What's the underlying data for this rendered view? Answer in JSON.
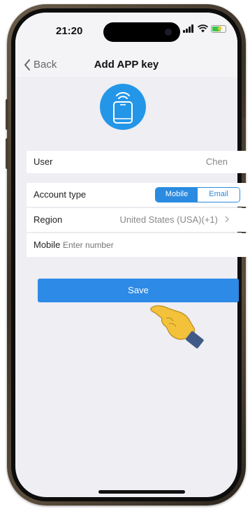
{
  "status_bar": {
    "time": "21:20"
  },
  "nav": {
    "back_label": "Back",
    "title": "Add APP key"
  },
  "user_row": {
    "label": "User",
    "value": "Chen"
  },
  "account_type_row": {
    "label": "Account type",
    "options": [
      "Mobile",
      "Email"
    ],
    "selected": "Mobile"
  },
  "region_row": {
    "label": "Region",
    "value": "United States (USA)(+1)"
  },
  "mobile_row": {
    "label": "Mobile",
    "placeholder": "Enter number",
    "value": ""
  },
  "save_button": {
    "label": "Save"
  },
  "colors": {
    "accent": "#2d8ae6",
    "screen_bg": "#eeeef3",
    "battery": "#37c24a"
  },
  "icons": [
    "chevron-left-icon",
    "remote-phone-icon",
    "chevron-right-icon",
    "pointing-hand-icon",
    "signal-icon",
    "wifi-icon",
    "battery-charging-icon"
  ]
}
